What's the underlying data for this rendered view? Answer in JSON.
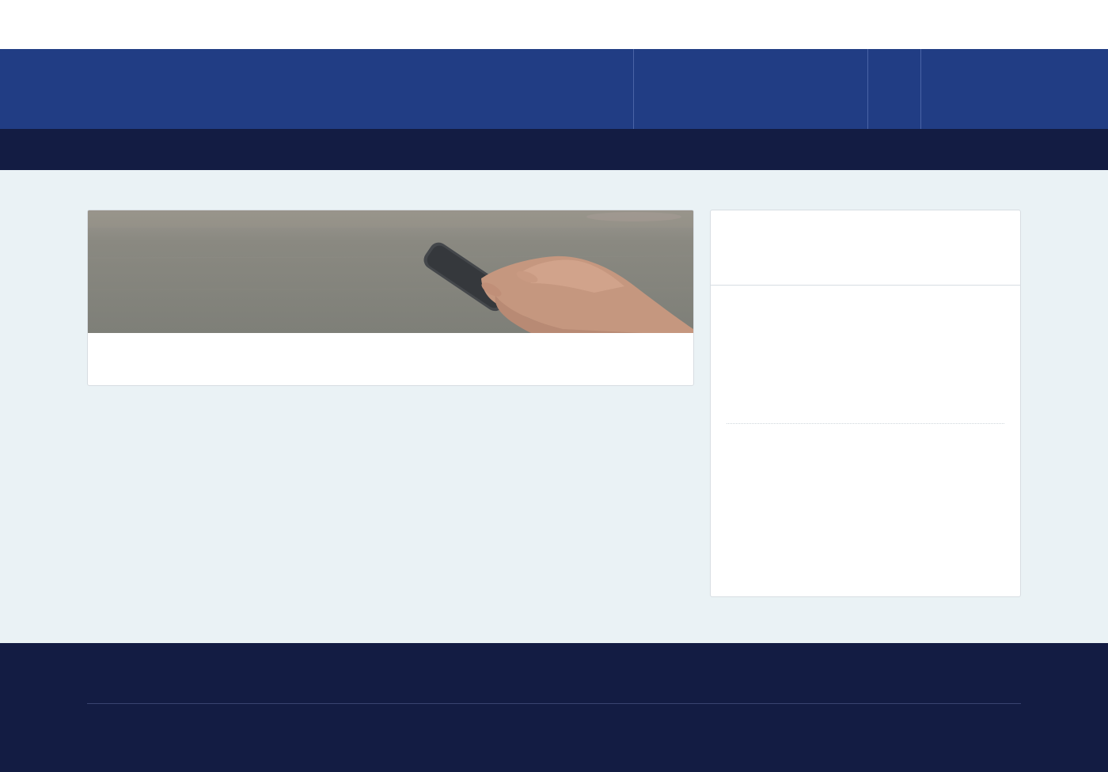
{
  "colors": {
    "header_blue": "#213d84",
    "nav_dark": "#131c43",
    "page_background": "#eaf2f5",
    "card_background": "#ffffff",
    "footer_dark": "#131c43"
  },
  "hero": {
    "image_icon": "phone-in-hands-photo"
  }
}
